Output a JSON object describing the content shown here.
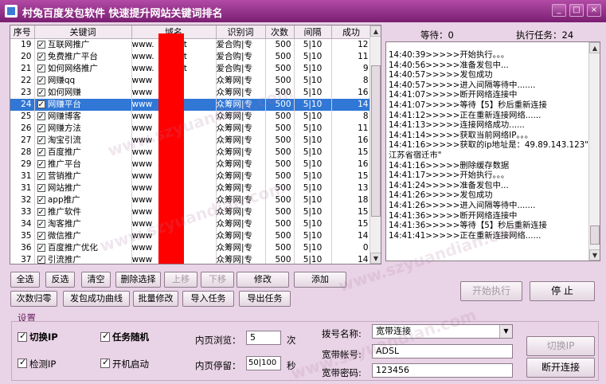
{
  "window": {
    "title": "村兔百度发包软件 快速提升网站关键词排名",
    "buttons": [
      "_",
      "□",
      "×"
    ]
  },
  "table": {
    "columns": [
      "序号",
      "关键词",
      "域名",
      "识别词",
      "次数",
      "间隔",
      "成功"
    ],
    "rows": [
      {
        "no": "19",
        "kw": "互联网推广",
        "domain": "www.",
        "domain_tail": "u.net",
        "ident": "爱合购|专",
        "cnt": "500",
        "intv": "5|10",
        "ok": "12"
      },
      {
        "no": "20",
        "kw": "免费推广平台",
        "domain": "www.",
        "domain_tail": "u.net",
        "ident": "爱合购|专",
        "cnt": "500",
        "intv": "5|10",
        "ok": "11"
      },
      {
        "no": "21",
        "kw": "如何网络推广",
        "domain": "www.",
        "domain_tail": "u.net",
        "ident": "爱合购|专",
        "cnt": "500",
        "intv": "5|10",
        "ok": "9"
      },
      {
        "no": "22",
        "kw": "网赚qq",
        "domain": "www",
        "domain_tail": "",
        "ident": "众筹网|专",
        "cnt": "500",
        "intv": "5|10",
        "ok": "8"
      },
      {
        "no": "23",
        "kw": "如何网赚",
        "domain": "www",
        "domain_tail": "",
        "ident": "众筹网|专",
        "cnt": "500",
        "intv": "5|10",
        "ok": "16"
      },
      {
        "no": "24",
        "kw": "网赚平台",
        "domain": "www",
        "domain_tail": "",
        "ident": "众筹网|专",
        "cnt": "500",
        "intv": "5|10",
        "ok": "14",
        "selected": true
      },
      {
        "no": "25",
        "kw": "网赚博客",
        "domain": "www",
        "domain_tail": "",
        "ident": "众筹网|专",
        "cnt": "500",
        "intv": "5|10",
        "ok": "8"
      },
      {
        "no": "26",
        "kw": "网赚方法",
        "domain": "www",
        "domain_tail": "",
        "ident": "众筹网|专",
        "cnt": "500",
        "intv": "5|10",
        "ok": "11"
      },
      {
        "no": "27",
        "kw": "淘宝引流",
        "domain": "www",
        "domain_tail": "",
        "ident": "众筹网|专",
        "cnt": "500",
        "intv": "5|10",
        "ok": "16"
      },
      {
        "no": "28",
        "kw": "百度推广",
        "domain": "www",
        "domain_tail": "",
        "ident": "众筹网|专",
        "cnt": "500",
        "intv": "5|10",
        "ok": "15"
      },
      {
        "no": "29",
        "kw": "推广平台",
        "domain": "www",
        "domain_tail": "",
        "ident": "众筹网|专",
        "cnt": "500",
        "intv": "5|10",
        "ok": "16"
      },
      {
        "no": "31",
        "kw": "营销推广",
        "domain": "www",
        "domain_tail": "",
        "ident": "众筹网|专",
        "cnt": "500",
        "intv": "5|10",
        "ok": "15"
      },
      {
        "no": "31",
        "kw": "网站推广",
        "domain": "www",
        "domain_tail": "",
        "ident": "众筹网|专",
        "cnt": "500",
        "intv": "5|10",
        "ok": "13"
      },
      {
        "no": "32",
        "kw": "app推广",
        "domain": "www",
        "domain_tail": "",
        "ident": "众筹网|专",
        "cnt": "500",
        "intv": "5|10",
        "ok": "18"
      },
      {
        "no": "33",
        "kw": "推广软件",
        "domain": "www",
        "domain_tail": "",
        "ident": "众筹网|专",
        "cnt": "500",
        "intv": "5|10",
        "ok": "15"
      },
      {
        "no": "34",
        "kw": "淘客推广",
        "domain": "www",
        "domain_tail": "",
        "ident": "众筹网|专",
        "cnt": "500",
        "intv": "5|10",
        "ok": "15"
      },
      {
        "no": "35",
        "kw": "微信推广",
        "domain": "www",
        "domain_tail": "",
        "ident": "众筹网|专",
        "cnt": "500",
        "intv": "5|10",
        "ok": "14"
      },
      {
        "no": "36",
        "kw": "百度推广优化",
        "domain": "www",
        "domain_tail": "",
        "ident": "众筹网|专",
        "cnt": "500",
        "intv": "5|10",
        "ok": "0"
      },
      {
        "no": "37",
        "kw": "引流推广",
        "domain": "www",
        "domain_tail": "",
        "ident": "众筹网|专",
        "cnt": "500",
        "intv": "5|10",
        "ok": "14"
      }
    ]
  },
  "status": {
    "waiting_label": "等待：",
    "waiting_value": "0",
    "running_label": "执行任务：",
    "running_value": "24"
  },
  "log": [
    "14:40:39>>>>>开始执行。。。",
    "14:40:56>>>>>准备发包中...",
    "14:40:57>>>>>发包成功",
    "14:40:57>>>>>进入间隔等待中.......",
    "14:41:07>>>>>断开网络连接中",
    "14:41:07>>>>>等待【5】秒后重新连接",
    "14:41:12>>>>>正在重新连接网络......",
    "14:41:13>>>>>连接网络成功......",
    "14:41:14>>>>>获取当前网络IP。。。",
    "14:41:16>>>>>获取的ip地址是：49.89.143.123\" \"",
    "江苏省宿迁市\"",
    "14:41:16>>>>>删除缓存数据",
    "14:41:17>>>>>开始执行。。。",
    "14:41:24>>>>>准备发包中...",
    "14:41:26>>>>>发包成功",
    "14:41:26>>>>>进入间隔等待中.......",
    "14:41:36>>>>>断开网络连接中",
    "14:41:36>>>>>等待【5】秒后重新连接",
    "14:41:41>>>>>正在重新连接网络......"
  ],
  "buttons_row1": [
    "全选",
    "反选",
    "清空",
    "删除选择",
    "上移",
    "下移",
    "修改",
    "添加"
  ],
  "buttons_row2": [
    "次数归零",
    "发包成功曲线",
    "批量修改",
    "导入任务",
    "导出任务"
  ],
  "actions": {
    "start": "开始执行",
    "stop": "停 止",
    "switch_ip": "切换IP",
    "disconnect": "断开连接"
  },
  "settings": {
    "title": "设置",
    "switch_ip": "切换IP",
    "random_task": "任务随机",
    "detect_ip": "检测IP",
    "auto_start": "开机启动",
    "inner_browse_label": "内页浏览：",
    "inner_browse_value": "5",
    "inner_browse_unit": "次",
    "inner_stay_label": "内页停留：",
    "inner_stay_value": "50|100",
    "inner_stay_unit": "秒",
    "dial_name_label": "拨号名称:",
    "dial_name_value": "宽带连接",
    "account_label": "宽带帐号:",
    "account_value": "ADSL",
    "password_label": "宽带密码:",
    "password_value": "123456"
  },
  "watermark": "www.szyuandian.com"
}
